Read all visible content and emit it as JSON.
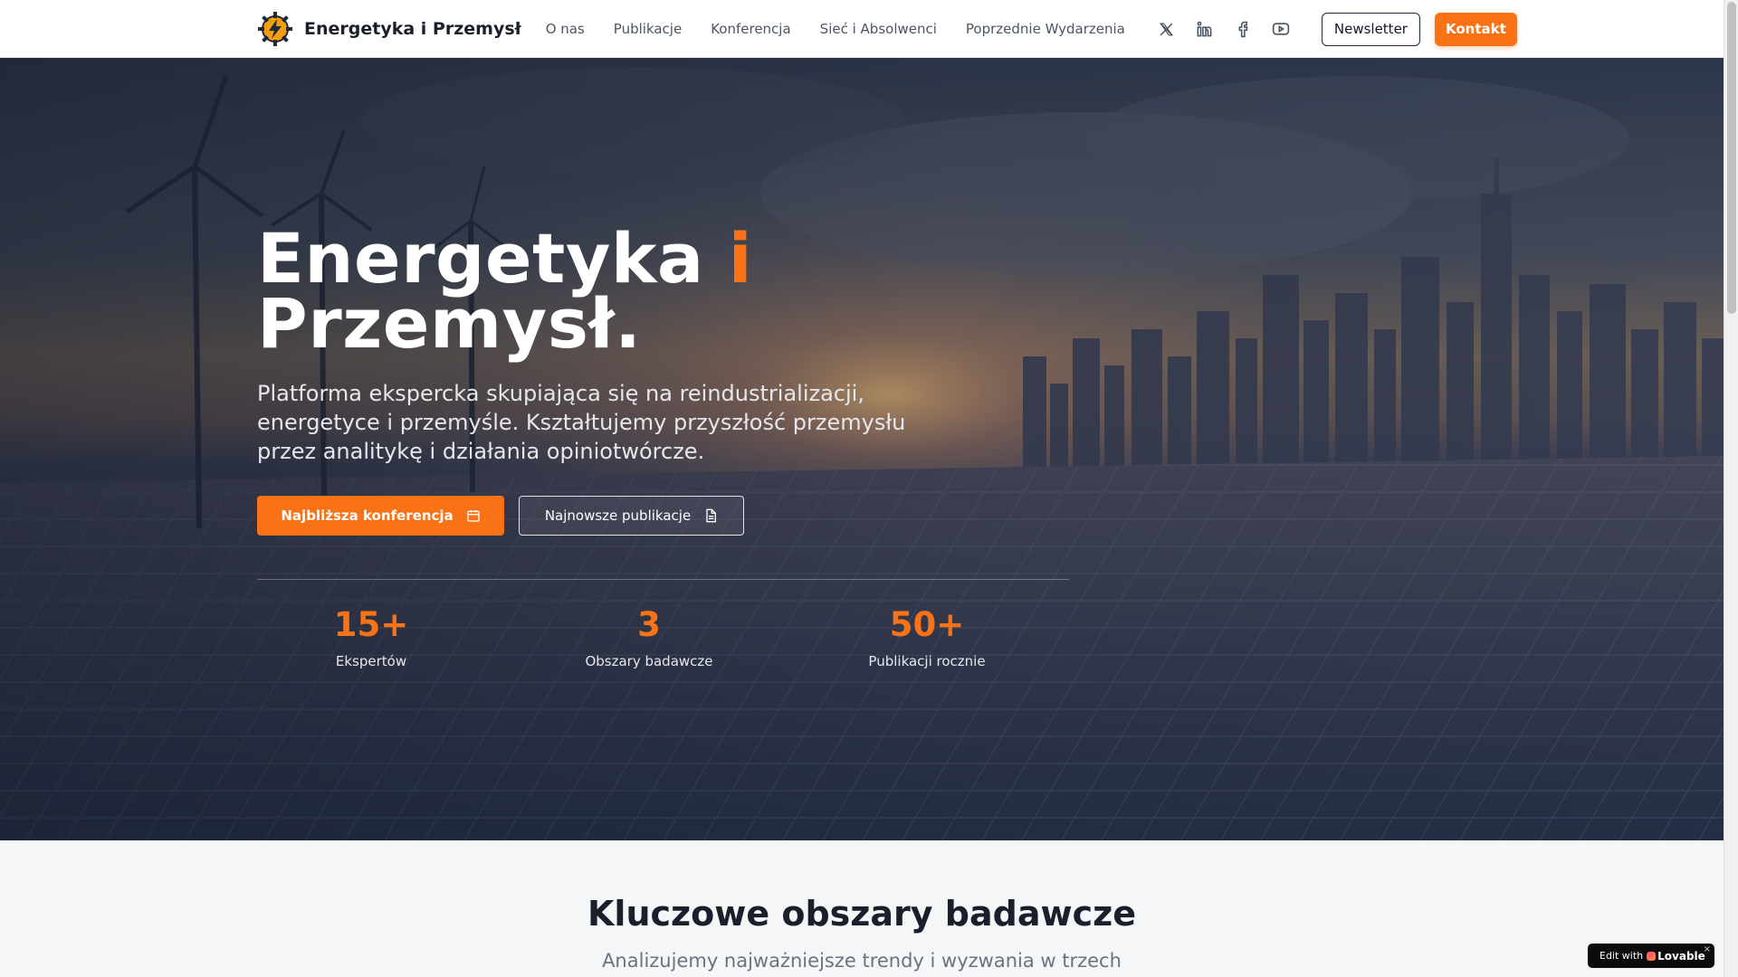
{
  "header": {
    "brand": "Energetyka i Przemysł",
    "nav": [
      "O nas",
      "Publikacje",
      "Konferencja",
      "Sieć i Absolwenci",
      "Poprzednie Wydarzenia"
    ],
    "socials": [
      "x-icon",
      "linkedin-icon",
      "facebook-icon",
      "youtube-icon"
    ],
    "newsletter_label": "Newsletter",
    "contact_label": "Kontakt"
  },
  "hero": {
    "title_part1": "Energetyka ",
    "title_accent": "i",
    "title_part2": "Przemysł.",
    "subtitle": "Platforma ekspercka skupiająca się na reindustrializacji, energetyce i przemyśle. Kształtujemy przyszłość przemysłu przez analitykę i działania opiniotwórcze.",
    "primary_cta": "Najbliższa konferencja",
    "primary_cta_icon": "calendar-icon",
    "secondary_cta": "Najnowsze publikacje",
    "secondary_cta_icon": "document-icon",
    "stats": [
      {
        "value": "15+",
        "label": "Ekspertów"
      },
      {
        "value": "3",
        "label": "Obszary badawcze"
      },
      {
        "value": "50+",
        "label": "Publikacji rocznie"
      }
    ]
  },
  "section": {
    "title": "Kluczowe obszary badawcze",
    "subtitle": "Analizujemy najważniejsze trendy i wyzwania w trzech"
  },
  "badge": {
    "prefix": "Edit with",
    "brand": "Lovable",
    "close": "×"
  },
  "colors": {
    "accent": "#f97316",
    "text_dark": "#1a1f2b",
    "muted": "#6b7280"
  }
}
